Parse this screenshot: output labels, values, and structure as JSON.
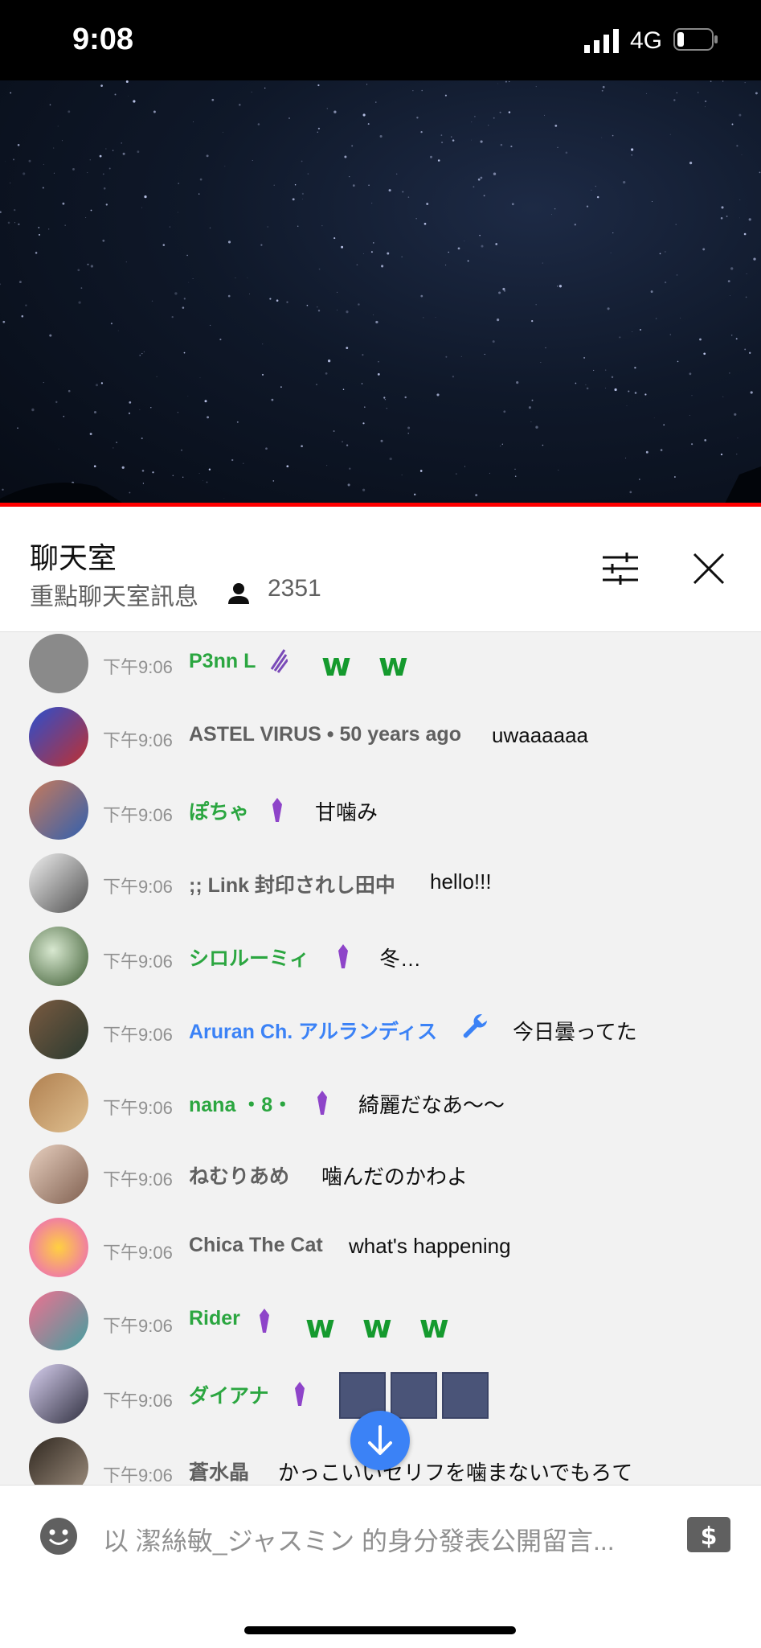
{
  "status_bar": {
    "time": "9:08",
    "network": "4G"
  },
  "chat_header": {
    "title": "聊天室",
    "subtitle": "重點聊天室訊息",
    "viewer_count": "2351"
  },
  "messages": [
    {
      "time": "下午9:06",
      "author": "P3nn L",
      "text": "",
      "emoji": "w w",
      "author_color": "#2ba640"
    },
    {
      "time": "下午9:06",
      "author": "ASTEL VIRUS • 50 years ago",
      "text": "uwaaaaaa",
      "author_color": "#606060"
    },
    {
      "time": "下午9:06",
      "author": "ぽちゃ",
      "text": "甘噛み",
      "author_color": "#2ba640"
    },
    {
      "time": "下午9:06",
      "author": ";; Link 封印されし田中",
      "text": "hello!!!",
      "author_color": "#606060"
    },
    {
      "time": "下午9:06",
      "author": "シロルーミィ",
      "text": "冬…",
      "author_color": "#2ba640"
    },
    {
      "time": "下午9:06",
      "author": "Aruran Ch. アルランディス",
      "text": "今日曇ってた",
      "author_color": "#3b82f6"
    },
    {
      "time": "下午9:06",
      "author": "nana ・8・",
      "text": "綺麗だなあ～～",
      "author_color": "#2ba640"
    },
    {
      "time": "下午9:06",
      "author": "ねむりあめ",
      "text": "噛んだのかわよ",
      "author_color": "#606060"
    },
    {
      "time": "下午9:06",
      "author": "Chica The Cat",
      "text": "what's happening",
      "author_color": "#606060"
    },
    {
      "time": "下午9:06",
      "author": "Rider",
      "text": "",
      "emoji": "w w w",
      "author_color": "#2ba640"
    },
    {
      "time": "下午9:06",
      "author": "ダイアナ",
      "text": "",
      "author_color": "#2ba640"
    },
    {
      "time": "下午9:06",
      "author": "蒼水晶",
      "text": "かっこいいセリフを噛まないでもろて",
      "author_color": "#606060"
    }
  ],
  "input": {
    "placeholder": "以 潔絲敏_ジャスミン 的身分發表公開留言..."
  },
  "colors": {
    "member_green": "#2ba640",
    "moderator_blue": "#3b82f6",
    "accent_red": "#ff0000",
    "jump_button": "#3b82f6"
  }
}
